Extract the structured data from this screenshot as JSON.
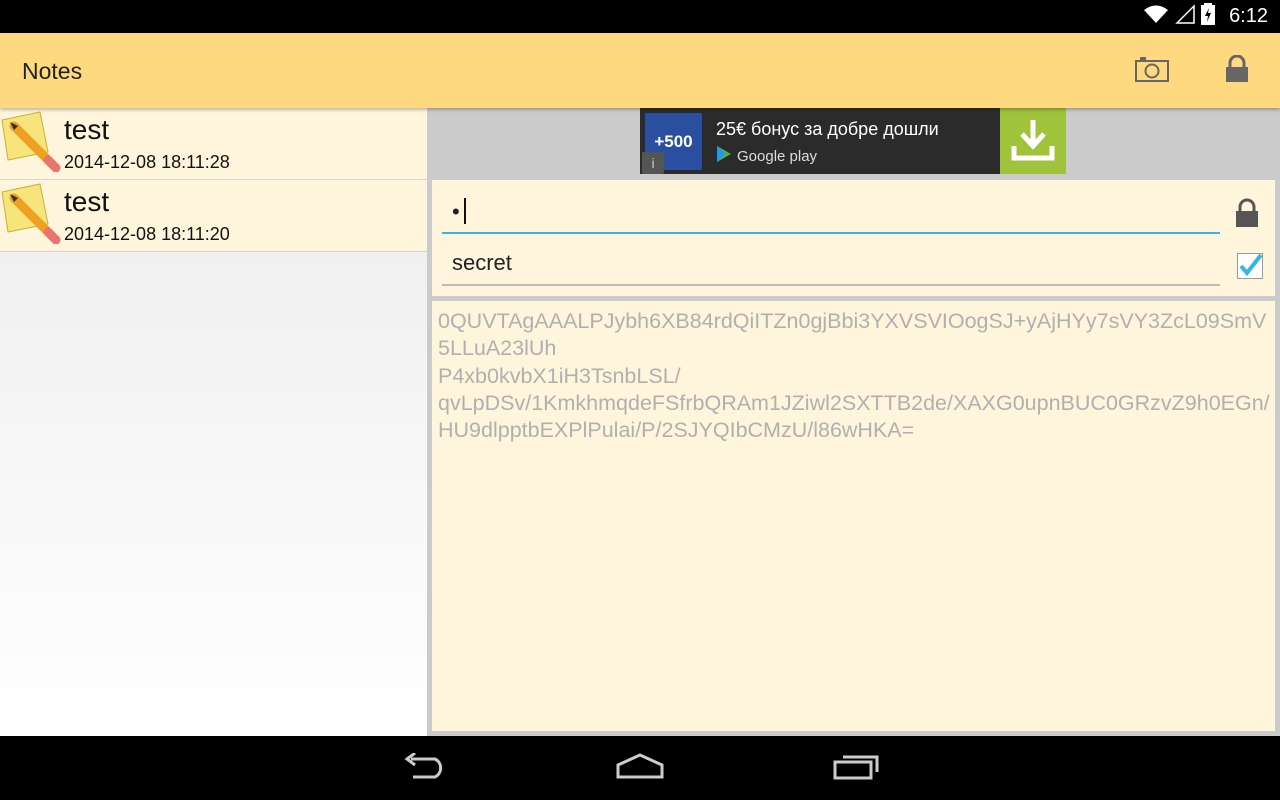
{
  "status_bar": {
    "time": "6:12"
  },
  "action_bar": {
    "title": "Notes",
    "icons": [
      "camera-icon",
      "lock-icon"
    ]
  },
  "notes": [
    {
      "title": "test",
      "date": "2014-12-08 18:11:28"
    },
    {
      "title": "test",
      "date": "2014-12-08 18:11:20"
    }
  ],
  "ad": {
    "logo_text": "+500",
    "headline": "25€ бонус за добре дошли",
    "store": "Google play",
    "info": "i"
  },
  "form": {
    "password_value": "•",
    "title_value": "secret",
    "save_checked": true
  },
  "body": {
    "text": "0QUVTAgAAALPJybh6XB84rdQiITZn0gjBbi3YXVSVIOogSJ+yAjHYy7sVY3ZcL09SmV5LLuA23lUh\nP4xb0kvbX1iH3TsnbLSL/\nqvLpDSv/1KmkhmqdeFSfrbQRAm1JZiwl2SXTTB2de/XAXG0upnBUC0GRzvZ9h0EGn/HU9dlpptbEXPlPulai/P/2SJYQIbCMzU/l86wHKA="
  },
  "colors": {
    "action_bar": "#ffd97f",
    "note_bg": "#fff5dc",
    "accent": "#33b5e5",
    "ad_download": "#9fc33b"
  }
}
